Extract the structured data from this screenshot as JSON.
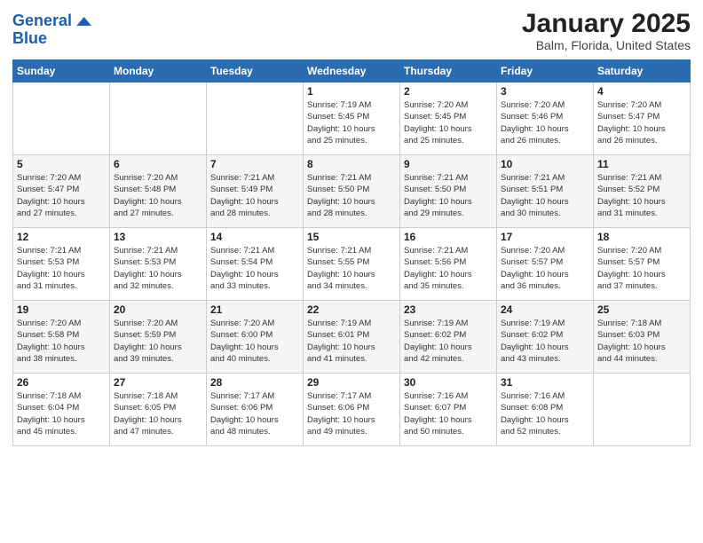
{
  "header": {
    "logo_line1": "General",
    "logo_line2": "Blue",
    "month_title": "January 2025",
    "location": "Balm, Florida, United States"
  },
  "weekdays": [
    "Sunday",
    "Monday",
    "Tuesday",
    "Wednesday",
    "Thursday",
    "Friday",
    "Saturday"
  ],
  "weeks": [
    [
      {
        "day": "",
        "info": ""
      },
      {
        "day": "",
        "info": ""
      },
      {
        "day": "",
        "info": ""
      },
      {
        "day": "1",
        "info": "Sunrise: 7:19 AM\nSunset: 5:45 PM\nDaylight: 10 hours\nand 25 minutes."
      },
      {
        "day": "2",
        "info": "Sunrise: 7:20 AM\nSunset: 5:45 PM\nDaylight: 10 hours\nand 25 minutes."
      },
      {
        "day": "3",
        "info": "Sunrise: 7:20 AM\nSunset: 5:46 PM\nDaylight: 10 hours\nand 26 minutes."
      },
      {
        "day": "4",
        "info": "Sunrise: 7:20 AM\nSunset: 5:47 PM\nDaylight: 10 hours\nand 26 minutes."
      }
    ],
    [
      {
        "day": "5",
        "info": "Sunrise: 7:20 AM\nSunset: 5:47 PM\nDaylight: 10 hours\nand 27 minutes."
      },
      {
        "day": "6",
        "info": "Sunrise: 7:20 AM\nSunset: 5:48 PM\nDaylight: 10 hours\nand 27 minutes."
      },
      {
        "day": "7",
        "info": "Sunrise: 7:21 AM\nSunset: 5:49 PM\nDaylight: 10 hours\nand 28 minutes."
      },
      {
        "day": "8",
        "info": "Sunrise: 7:21 AM\nSunset: 5:50 PM\nDaylight: 10 hours\nand 28 minutes."
      },
      {
        "day": "9",
        "info": "Sunrise: 7:21 AM\nSunset: 5:50 PM\nDaylight: 10 hours\nand 29 minutes."
      },
      {
        "day": "10",
        "info": "Sunrise: 7:21 AM\nSunset: 5:51 PM\nDaylight: 10 hours\nand 30 minutes."
      },
      {
        "day": "11",
        "info": "Sunrise: 7:21 AM\nSunset: 5:52 PM\nDaylight: 10 hours\nand 31 minutes."
      }
    ],
    [
      {
        "day": "12",
        "info": "Sunrise: 7:21 AM\nSunset: 5:53 PM\nDaylight: 10 hours\nand 31 minutes."
      },
      {
        "day": "13",
        "info": "Sunrise: 7:21 AM\nSunset: 5:53 PM\nDaylight: 10 hours\nand 32 minutes."
      },
      {
        "day": "14",
        "info": "Sunrise: 7:21 AM\nSunset: 5:54 PM\nDaylight: 10 hours\nand 33 minutes."
      },
      {
        "day": "15",
        "info": "Sunrise: 7:21 AM\nSunset: 5:55 PM\nDaylight: 10 hours\nand 34 minutes."
      },
      {
        "day": "16",
        "info": "Sunrise: 7:21 AM\nSunset: 5:56 PM\nDaylight: 10 hours\nand 35 minutes."
      },
      {
        "day": "17",
        "info": "Sunrise: 7:20 AM\nSunset: 5:57 PM\nDaylight: 10 hours\nand 36 minutes."
      },
      {
        "day": "18",
        "info": "Sunrise: 7:20 AM\nSunset: 5:57 PM\nDaylight: 10 hours\nand 37 minutes."
      }
    ],
    [
      {
        "day": "19",
        "info": "Sunrise: 7:20 AM\nSunset: 5:58 PM\nDaylight: 10 hours\nand 38 minutes."
      },
      {
        "day": "20",
        "info": "Sunrise: 7:20 AM\nSunset: 5:59 PM\nDaylight: 10 hours\nand 39 minutes."
      },
      {
        "day": "21",
        "info": "Sunrise: 7:20 AM\nSunset: 6:00 PM\nDaylight: 10 hours\nand 40 minutes."
      },
      {
        "day": "22",
        "info": "Sunrise: 7:19 AM\nSunset: 6:01 PM\nDaylight: 10 hours\nand 41 minutes."
      },
      {
        "day": "23",
        "info": "Sunrise: 7:19 AM\nSunset: 6:02 PM\nDaylight: 10 hours\nand 42 minutes."
      },
      {
        "day": "24",
        "info": "Sunrise: 7:19 AM\nSunset: 6:02 PM\nDaylight: 10 hours\nand 43 minutes."
      },
      {
        "day": "25",
        "info": "Sunrise: 7:18 AM\nSunset: 6:03 PM\nDaylight: 10 hours\nand 44 minutes."
      }
    ],
    [
      {
        "day": "26",
        "info": "Sunrise: 7:18 AM\nSunset: 6:04 PM\nDaylight: 10 hours\nand 45 minutes."
      },
      {
        "day": "27",
        "info": "Sunrise: 7:18 AM\nSunset: 6:05 PM\nDaylight: 10 hours\nand 47 minutes."
      },
      {
        "day": "28",
        "info": "Sunrise: 7:17 AM\nSunset: 6:06 PM\nDaylight: 10 hours\nand 48 minutes."
      },
      {
        "day": "29",
        "info": "Sunrise: 7:17 AM\nSunset: 6:06 PM\nDaylight: 10 hours\nand 49 minutes."
      },
      {
        "day": "30",
        "info": "Sunrise: 7:16 AM\nSunset: 6:07 PM\nDaylight: 10 hours\nand 50 minutes."
      },
      {
        "day": "31",
        "info": "Sunrise: 7:16 AM\nSunset: 6:08 PM\nDaylight: 10 hours\nand 52 minutes."
      },
      {
        "day": "",
        "info": ""
      }
    ]
  ]
}
